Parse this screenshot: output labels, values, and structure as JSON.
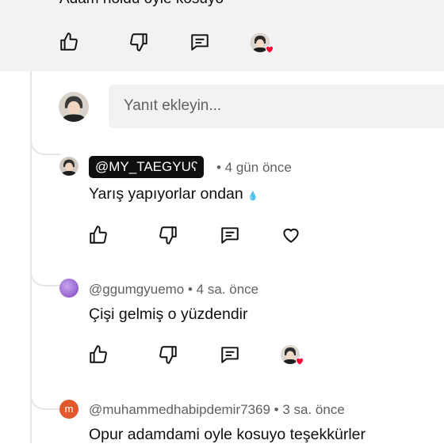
{
  "top_comment": {
    "text": "Adam noldu oyle kosuyo"
  },
  "reply_box": {
    "placeholder": "Yanıt ekleyin..."
  },
  "replies": [
    {
      "handle": "@MY_TAEGYUʕ",
      "time": "• 4 gün önce",
      "text": "Yarış yapıyorlar ondan",
      "emoji": "💧"
    },
    {
      "handle": "@ggumgyuemo",
      "time": "• 4 sa. önce",
      "text": "Çişi gelmiş o yüzdendir"
    },
    {
      "handle": "@muhammedhabipdemir7369",
      "time": "• 3 sa. önce",
      "text": "Opur adamdami oyle kosuyo teşekkürler",
      "avatar_letter": "m"
    }
  ],
  "colors": {
    "accent_heart": "#ff0033",
    "avatar_orange": "#e4572e",
    "avatar_purple": "#9b6bd3"
  },
  "icons": [
    "like-icon",
    "dislike-icon",
    "reply-icon",
    "creator-heart-icon",
    "heart-outline-icon"
  ]
}
